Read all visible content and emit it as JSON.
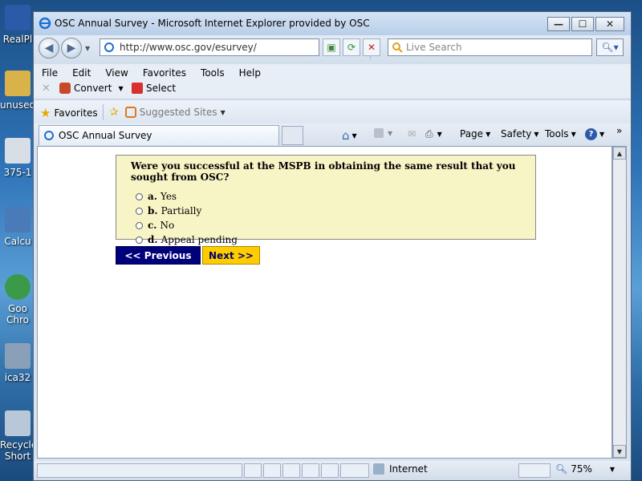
{
  "desktop": {
    "icons": [
      {
        "label": "RealPl",
        "color": "#2b5aa8"
      },
      {
        "label": "unused",
        "color": "#d9b24a"
      },
      {
        "label": "375-1",
        "color": "#d8dee6"
      },
      {
        "label": "Calcu",
        "color": "#4a7ab8"
      },
      {
        "label": "Goo Chro",
        "color": "#3a9a4a"
      },
      {
        "label": "ica32",
        "color": "#8aa0b8"
      },
      {
        "label": "Recycle Short",
        "color": "#b8c8d8"
      }
    ]
  },
  "window": {
    "title": "OSC Annual Survey - Microsoft Internet Explorer provided by OSC",
    "minimize": "—",
    "maximize": "☐",
    "close": "✕"
  },
  "address_bar": {
    "url": "http://www.osc.gov/esurvey/"
  },
  "search": {
    "placeholder": "Live Search"
  },
  "menu": {
    "items": [
      "File",
      "Edit",
      "View",
      "Favorites",
      "Tools",
      "Help"
    ]
  },
  "convert_toolbar": {
    "convert_label": "Convert",
    "select_label": "Select"
  },
  "favorites_bar": {
    "favorites_label": "Favorites",
    "suggested_label": "Suggested Sites"
  },
  "tabs": {
    "active_title": "OSC Annual Survey"
  },
  "command_bar": {
    "page_label": "Page",
    "safety_label": "Safety",
    "tools_label": "Tools",
    "overflow_label": "»"
  },
  "survey": {
    "question": "Were you successful at the MSPB in obtaining the same result that you sought from OSC?",
    "options": [
      {
        "letter": "a.",
        "text": "Yes",
        "selected": false
      },
      {
        "letter": "b.",
        "text": "Partially",
        "selected": false
      },
      {
        "letter": "c.",
        "text": "No",
        "selected": false
      },
      {
        "letter": "d.",
        "text": "Appeal pending",
        "selected": false
      }
    ],
    "prev_label": "<< Previous",
    "next_label": "Next >>"
  },
  "status_bar": {
    "zone_label": "Internet",
    "zoom_label": "75%"
  },
  "colors": {
    "survey_bg": "#f7f4c5",
    "prev_bg": "#00007a",
    "next_bg": "#ffcc00"
  }
}
